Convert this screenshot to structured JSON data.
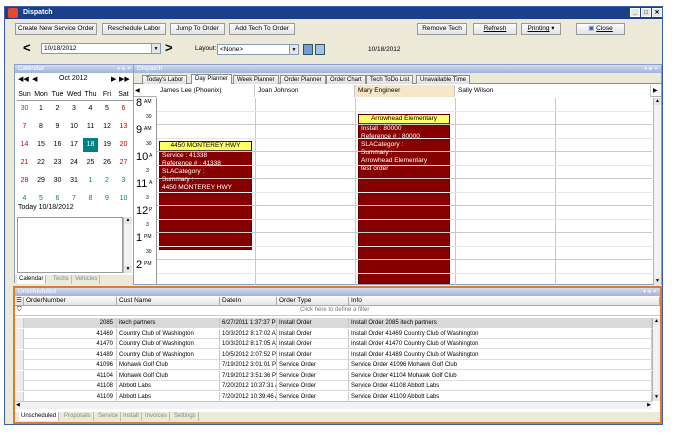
{
  "window": {
    "title": "Dispatch"
  },
  "toolbar": {
    "create_service_order": "Create New Service Order",
    "reschedule_labor": "Reschedule Labor",
    "jump_to_order": "Jump To Order",
    "add_tech_to_order": "Add Tech To Order",
    "remove_tech": "Remove Tech",
    "refresh": "Refresh",
    "printing": "Printing",
    "close": "Close"
  },
  "datebar": {
    "date_value": "10/18/2012",
    "layout_label": "Layout:",
    "layout_value": "<None>",
    "date_display": "10/18/2012"
  },
  "calendar_panel": {
    "title": "Calendar",
    "month_label": "Oct 2012",
    "weekdays": [
      "Sun",
      "Mon",
      "Tue",
      "Wed",
      "Thu",
      "Fri",
      "Sat"
    ],
    "weeks": [
      [
        "30",
        "1",
        "2",
        "3",
        "4",
        "5",
        "6"
      ],
      [
        "7",
        "8",
        "9",
        "10",
        "11",
        "12",
        "13"
      ],
      [
        "14",
        "15",
        "16",
        "17",
        "18",
        "19",
        "20"
      ],
      [
        "21",
        "22",
        "23",
        "24",
        "25",
        "26",
        "27"
      ],
      [
        "28",
        "29",
        "30",
        "31",
        "1",
        "2",
        "3"
      ],
      [
        "4",
        "5",
        "6",
        "7",
        "8",
        "9",
        "10"
      ]
    ],
    "today_label": "Today 10/18/2012",
    "tabs": [
      "Calendar",
      "Techs",
      "Vehicles"
    ]
  },
  "dispatch_panel": {
    "title": "Dispatch",
    "tabs": [
      "Today's Labor",
      "Day Planner",
      "Week Planner",
      "Order Planner",
      "Order Chart",
      "Tech ToDo List",
      "Unavailable Time"
    ],
    "techs": [
      "James Lee (Phoenix)",
      "Joan Johnson",
      "Mary Engineer",
      "Sally Wilson"
    ],
    "hours": [
      {
        "h": "8",
        "suffix": "AM",
        "half": "30"
      },
      {
        "h": "9",
        "suffix": "AM",
        "half": "30"
      },
      {
        "h": "10",
        "suffix": "A",
        "half": "3"
      },
      {
        "h": "11",
        "suffix": "A",
        "half": "3"
      },
      {
        "h": "12",
        "suffix": "P",
        "half": "3"
      },
      {
        "h": "1",
        "suffix": "PM",
        "half": "30"
      },
      {
        "h": "2",
        "suffix": "PM",
        "half": ""
      }
    ],
    "appointments": [
      {
        "header": "4450 MONTEREY HWY",
        "lines": [
          "Service : 41338",
          "Reference # : 41338",
          "SLACategory :",
          "Summary :",
          "4450 MONTEREY HWY"
        ]
      },
      {
        "header": "Arrowhead Elementary",
        "lines": [
          "Install : 80000",
          "Reference # : 80000",
          "SLACategory :",
          "Summary :",
          "Arrowhead Elementary",
          "test order"
        ]
      }
    ]
  },
  "unscheduled_panel": {
    "title": "Unscheduled",
    "columns": [
      "OrderNumber",
      "Cust Name",
      "DateIn",
      "Order Type",
      "Info"
    ],
    "filter_text": "Click here to define a filter",
    "rows": [
      [
        "2085",
        "itech partners",
        "6/27/2011 1:37:37 PM",
        "Install Order",
        "Install Order 2085 itech partners"
      ],
      [
        "41469",
        "Country Club of Washington",
        "10/3/2012 8:17:02 AM",
        "Install Order",
        "Install Order 41469 Country Club of Washington"
      ],
      [
        "41470",
        "Country Club of Washington",
        "10/3/2012 8:17:05 AM",
        "Install Order",
        "Install Order 41470 Country Club of Washington"
      ],
      [
        "41489",
        "Country Club of Washington",
        "10/5/2012 2:07:52 PM",
        "Install Order",
        "Install Order 41489 Country Club of Washington"
      ],
      [
        "41096",
        "Mohawk Golf Club",
        "7/19/2012 3:01:01 PM",
        "Service Order",
        "Service Order 41096 Mohawk Golf Club"
      ],
      [
        "41104",
        "Mohawk Golf Club",
        "7/19/2012 3:51:36 PM",
        "Service Order",
        "Service Order 41104 Mohawk Golf Club"
      ],
      [
        "41108",
        "Abbott Labs",
        "7/20/2012 10:37:31 AM",
        "Service Order",
        "Service Order 41108 Abbott Labs"
      ],
      [
        "41109",
        "Abbott Labs",
        "7/20/2012 10:39:46 AM",
        "Service Order",
        "Service Order 41109 Abbott Labs"
      ]
    ],
    "tabs": [
      "Unscheduled",
      "Proposals",
      "Service",
      "Install",
      "Invoices",
      "Settings"
    ]
  },
  "colors": {
    "titlebar": "#1b3f8b",
    "appointment": "#870000",
    "appointment_header": "#ffff66",
    "highlight_border": "#e07a2e",
    "today_cell": "#008080"
  }
}
